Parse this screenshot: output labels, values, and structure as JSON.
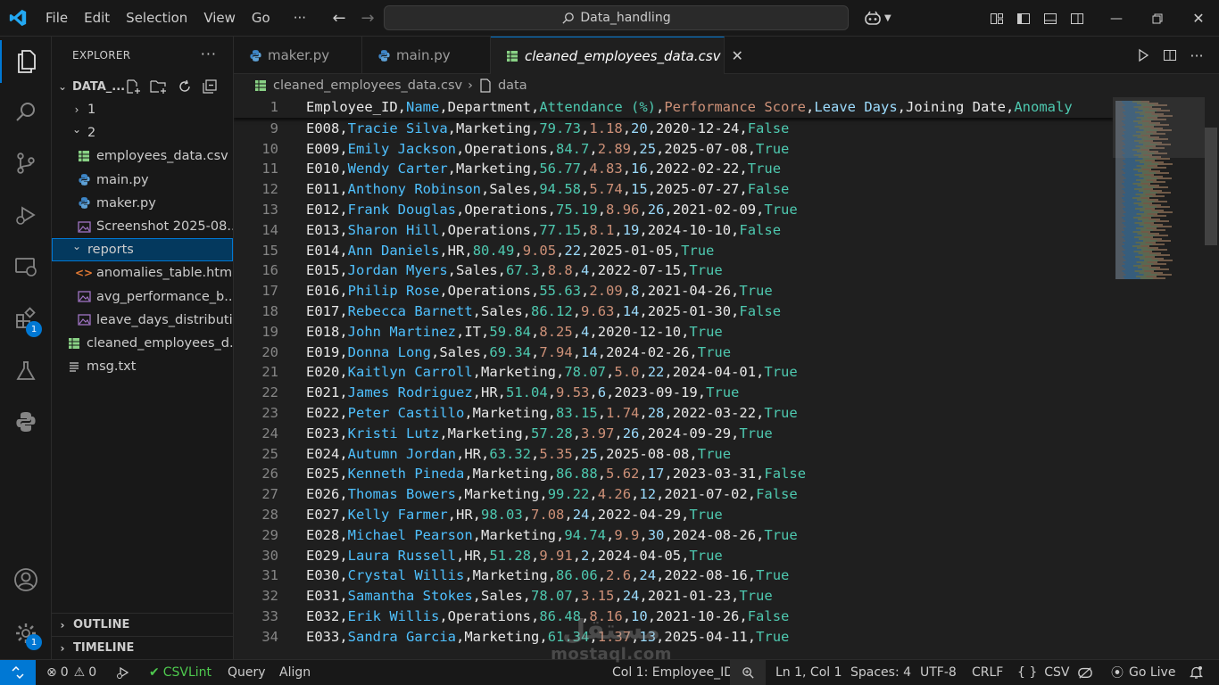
{
  "titlebar": {
    "menus": [
      "File",
      "Edit",
      "Selection",
      "View",
      "Go"
    ],
    "more": "···",
    "search": "Data_handling"
  },
  "sidebar": {
    "title": "EXPLORER",
    "root": "DATA_...",
    "tree": [
      {
        "label": "1",
        "kind": "folder-closed",
        "indent": 1
      },
      {
        "label": "2",
        "kind": "folder-open",
        "indent": 1
      },
      {
        "label": "employees_data.csv",
        "kind": "csv",
        "indent": 2
      },
      {
        "label": "main.py",
        "kind": "py",
        "indent": 2
      },
      {
        "label": "maker.py",
        "kind": "py",
        "indent": 2
      },
      {
        "label": "Screenshot 2025-08...",
        "kind": "img",
        "indent": 2
      },
      {
        "label": "reports",
        "kind": "folder-open",
        "indent": 1
      },
      {
        "label": "anomalies_table.html",
        "kind": "html",
        "indent": 2
      },
      {
        "label": "avg_performance_b...",
        "kind": "img",
        "indent": 2
      },
      {
        "label": "leave_days_distributi...",
        "kind": "img",
        "indent": 2
      },
      {
        "label": "cleaned_employees_d...",
        "kind": "csv",
        "indent": 1
      },
      {
        "label": "msg.txt",
        "kind": "txt",
        "indent": 1
      }
    ],
    "outline": "OUTLINE",
    "timeline": "TIMELINE",
    "badges": {
      "extensions": "1",
      "settings": "1"
    }
  },
  "tabs": [
    {
      "label": "maker.py",
      "active": false
    },
    {
      "label": "main.py",
      "active": false
    },
    {
      "label": "cleaned_employees_data.csv",
      "active": true
    }
  ],
  "breadcrumb": {
    "file": "cleaned_employees_data.csv",
    "symbol": "data"
  },
  "editor": {
    "header": {
      "num": "1",
      "fields": [
        "Employee_ID",
        "Name",
        "Department",
        "Attendance (%)",
        "Performance Score",
        "Leave Days",
        "Joining Date",
        "Anomaly"
      ]
    },
    "rows": [
      {
        "num": "9",
        "fields": [
          "E008",
          "Tracie Silva",
          "Marketing",
          "79.73",
          "1.18",
          "20",
          "2020-12-24",
          "False"
        ]
      },
      {
        "num": "10",
        "fields": [
          "E009",
          "Emily Jackson",
          "Operations",
          "84.7",
          "2.89",
          "25",
          "2025-07-08",
          "True"
        ]
      },
      {
        "num": "11",
        "fields": [
          "E010",
          "Wendy Carter",
          "Marketing",
          "56.77",
          "4.83",
          "16",
          "2022-02-22",
          "True"
        ]
      },
      {
        "num": "12",
        "fields": [
          "E011",
          "Anthony Robinson",
          "Sales",
          "94.58",
          "5.74",
          "15",
          "2025-07-27",
          "False"
        ]
      },
      {
        "num": "13",
        "fields": [
          "E012",
          "Frank Douglas",
          "Operations",
          "75.19",
          "8.96",
          "26",
          "2021-02-09",
          "True"
        ]
      },
      {
        "num": "14",
        "fields": [
          "E013",
          "Sharon Hill",
          "Operations",
          "77.15",
          "8.1",
          "19",
          "2024-10-10",
          "False"
        ]
      },
      {
        "num": "15",
        "fields": [
          "E014",
          "Ann Daniels",
          "HR",
          "80.49",
          "9.05",
          "22",
          "2025-01-05",
          "True"
        ]
      },
      {
        "num": "16",
        "fields": [
          "E015",
          "Jordan Myers",
          "Sales",
          "67.3",
          "8.8",
          "4",
          "2022-07-15",
          "True"
        ]
      },
      {
        "num": "17",
        "fields": [
          "E016",
          "Philip Rose",
          "Operations",
          "55.63",
          "2.09",
          "8",
          "2021-04-26",
          "True"
        ]
      },
      {
        "num": "18",
        "fields": [
          "E017",
          "Rebecca Barnett",
          "Sales",
          "86.12",
          "9.63",
          "14",
          "2025-01-30",
          "False"
        ]
      },
      {
        "num": "19",
        "fields": [
          "E018",
          "John Martinez",
          "IT",
          "59.84",
          "8.25",
          "4",
          "2020-12-10",
          "True"
        ]
      },
      {
        "num": "20",
        "fields": [
          "E019",
          "Donna Long",
          "Sales",
          "69.34",
          "7.94",
          "14",
          "2024-02-26",
          "True"
        ]
      },
      {
        "num": "21",
        "fields": [
          "E020",
          "Kaitlyn Carroll",
          "Marketing",
          "78.07",
          "5.0",
          "22",
          "2024-04-01",
          "True"
        ]
      },
      {
        "num": "22",
        "fields": [
          "E021",
          "James Rodriguez",
          "HR",
          "51.04",
          "9.53",
          "6",
          "2023-09-19",
          "True"
        ]
      },
      {
        "num": "23",
        "fields": [
          "E022",
          "Peter Castillo",
          "Marketing",
          "83.15",
          "1.74",
          "28",
          "2022-03-22",
          "True"
        ]
      },
      {
        "num": "24",
        "fields": [
          "E023",
          "Kristi Lutz",
          "Marketing",
          "57.28",
          "3.97",
          "26",
          "2024-09-29",
          "True"
        ]
      },
      {
        "num": "25",
        "fields": [
          "E024",
          "Autumn Jordan",
          "HR",
          "63.32",
          "5.35",
          "25",
          "2025-08-08",
          "True"
        ]
      },
      {
        "num": "26",
        "fields": [
          "E025",
          "Kenneth Pineda",
          "Marketing",
          "86.88",
          "5.62",
          "17",
          "2023-03-31",
          "False"
        ]
      },
      {
        "num": "27",
        "fields": [
          "E026",
          "Thomas Bowers",
          "Marketing",
          "99.22",
          "4.26",
          "12",
          "2021-07-02",
          "False"
        ]
      },
      {
        "num": "28",
        "fields": [
          "E027",
          "Kelly Farmer",
          "HR",
          "98.03",
          "7.08",
          "24",
          "2022-04-29",
          "True"
        ]
      },
      {
        "num": "29",
        "fields": [
          "E028",
          "Michael Pearson",
          "Marketing",
          "94.74",
          "9.9",
          "30",
          "2024-08-26",
          "True"
        ]
      },
      {
        "num": "30",
        "fields": [
          "E029",
          "Laura Russell",
          "HR",
          "51.28",
          "9.91",
          "2",
          "2024-04-05",
          "True"
        ]
      },
      {
        "num": "31",
        "fields": [
          "E030",
          "Crystal Willis",
          "Marketing",
          "86.06",
          "2.6",
          "24",
          "2022-08-16",
          "True"
        ]
      },
      {
        "num": "32",
        "fields": [
          "E031",
          "Samantha Stokes",
          "Sales",
          "78.07",
          "3.15",
          "24",
          "2021-01-23",
          "True"
        ]
      },
      {
        "num": "33",
        "fields": [
          "E032",
          "Erik Willis",
          "Operations",
          "86.48",
          "8.16",
          "10",
          "2021-10-26",
          "False"
        ]
      },
      {
        "num": "34",
        "fields": [
          "E033",
          "Sandra Garcia",
          "Marketing",
          "61.34",
          "1.37",
          "13",
          "2025-04-11",
          "True"
        ]
      }
    ]
  },
  "column_colors": [
    "#e8e8e8",
    "#4fc1ff",
    "#e8e8e8",
    "#4ec9b0",
    "#ce9178",
    "#9cdcfe",
    "#e8e8e8",
    "#4ec9b0"
  ],
  "statusbar": {
    "errors": "0",
    "warnings": "0",
    "csvlint": "CSVLint",
    "query": "Query",
    "align": "Align",
    "column": "Col 1: Employee_ID",
    "position": "Ln 1, Col 1",
    "spaces": "Spaces: 4",
    "encoding": "UTF-8",
    "eol": "CRLF",
    "language": "CSV",
    "golive": "Go Live"
  },
  "watermark": {
    "arabic": "مستقل",
    "latin": "mostaql.com"
  }
}
